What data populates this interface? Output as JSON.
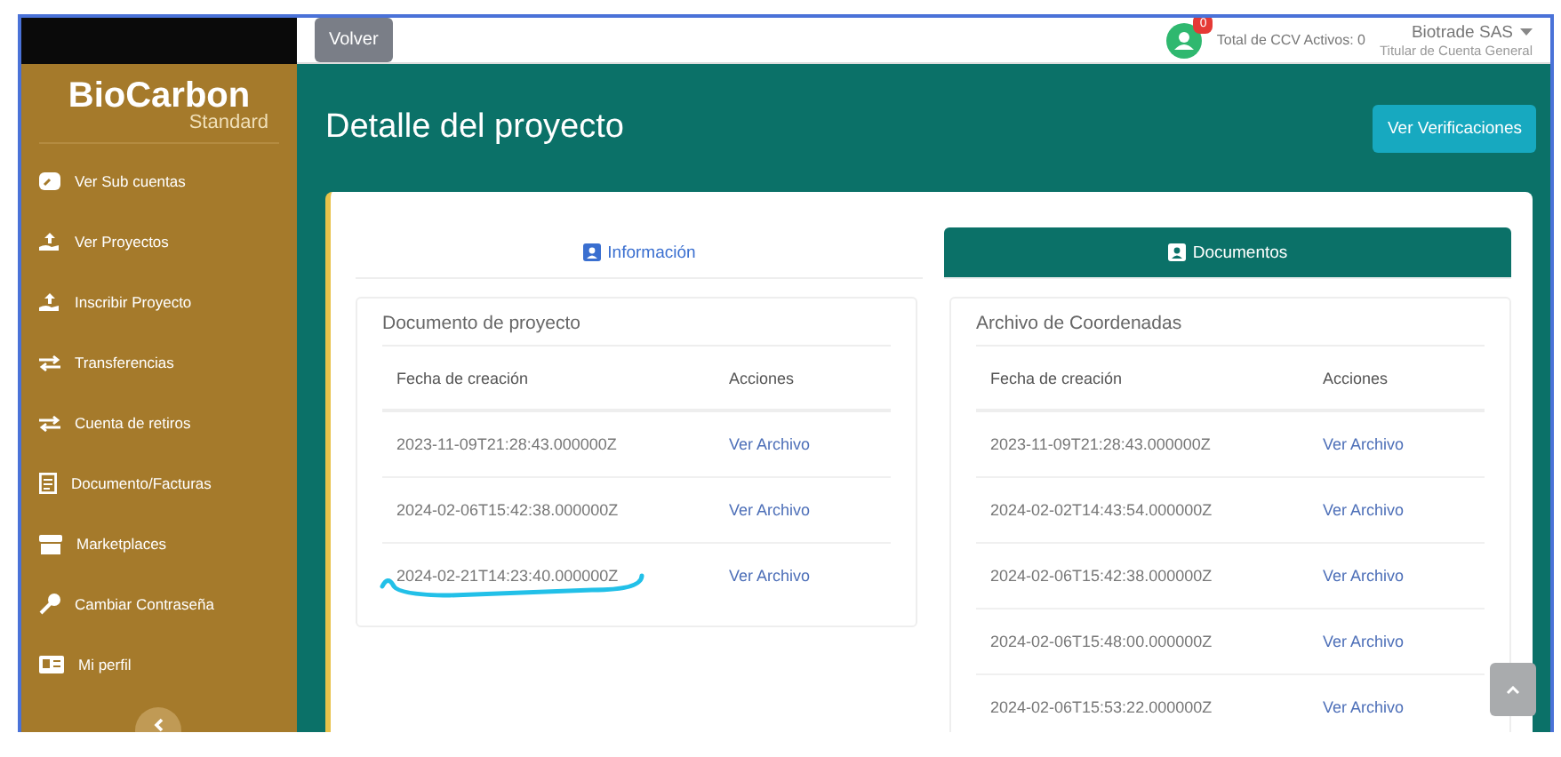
{
  "sidebar": {
    "logo": {
      "name": "BioCarbon",
      "tagline": "Standard"
    },
    "items": [
      {
        "label": "Ver Sub cuentas",
        "kind": "dashboard"
      },
      {
        "label": "Ver Proyectos",
        "kind": "upload"
      },
      {
        "label": "Inscribir Proyecto",
        "kind": "upload"
      },
      {
        "label": "Transferencias",
        "kind": "exchange"
      },
      {
        "label": "Cuenta de retiros",
        "kind": "exchange"
      },
      {
        "label": "Documento/Facturas",
        "kind": "document"
      },
      {
        "label": "Marketplaces",
        "kind": "store"
      },
      {
        "label": "Cambiar Contraseña",
        "kind": "key"
      },
      {
        "label": "Mi perfil",
        "kind": "card"
      }
    ]
  },
  "topbar": {
    "back_button": "Volver",
    "notification_count": "0",
    "total_label": "Total de CCV Activos: 0",
    "account_name": "Biotrade SAS",
    "account_role": "Titular de Cuenta General"
  },
  "header": {
    "title": "Detalle del proyecto",
    "button": "Ver Verificaciones"
  },
  "tabs": [
    {
      "label": "Información",
      "selected": false
    },
    {
      "label": "Documentos",
      "selected": true
    }
  ],
  "panels": [
    {
      "title": "Documento de proyecto",
      "columns": [
        "Fecha de creación",
        "Acciones"
      ],
      "rows": [
        {
          "date": "2023-11-09T21:28:43.000000Z",
          "action": "Ver Archivo",
          "underlined": false
        },
        {
          "date": "2024-02-06T15:42:38.000000Z",
          "action": "Ver Archivo",
          "underlined": false
        },
        {
          "date": "2024-02-21T14:23:40.000000Z",
          "action": "Ver Archivo",
          "underlined": true
        }
      ]
    },
    {
      "title": "Archivo de Coordenadas",
      "columns": [
        "Fecha de creación",
        "Acciones"
      ],
      "rows": [
        {
          "date": "2023-11-09T21:28:43.000000Z",
          "action": "Ver Archivo",
          "underlined": false
        },
        {
          "date": "2024-02-02T14:43:54.000000Z",
          "action": "Ver Archivo",
          "underlined": false
        },
        {
          "date": "2024-02-06T15:42:38.000000Z",
          "action": "Ver Archivo",
          "underlined": false
        },
        {
          "date": "2024-02-06T15:48:00.000000Z",
          "action": "Ver Archivo",
          "underlined": false
        },
        {
          "date": "2024-02-06T15:53:22.000000Z",
          "action": "Ver Archivo",
          "underlined": false
        }
      ]
    }
  ]
}
